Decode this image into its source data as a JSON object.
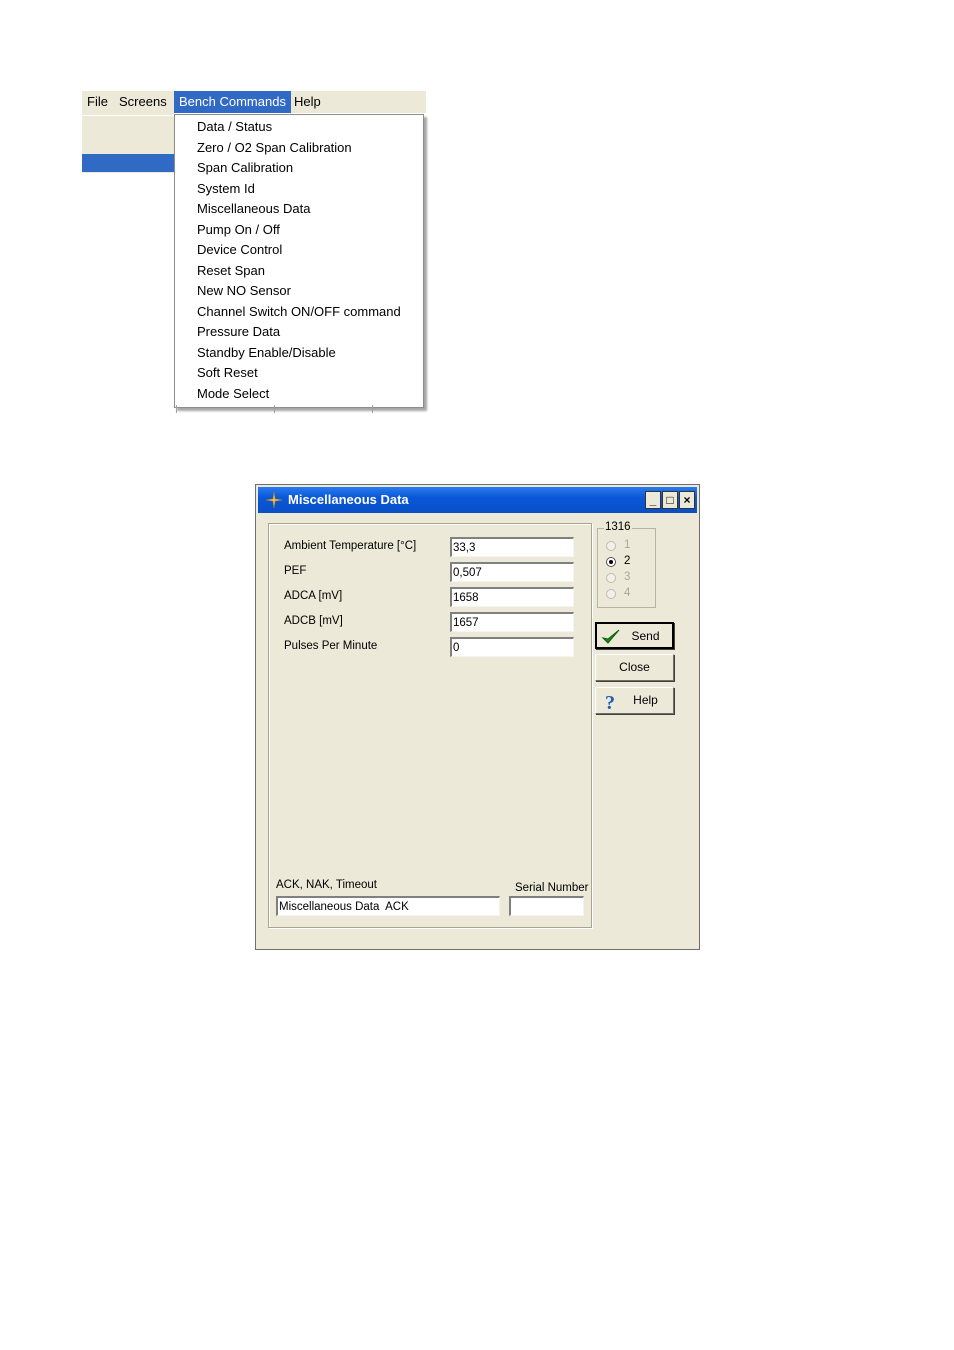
{
  "menubar": {
    "items": [
      {
        "label": "File"
      },
      {
        "label": "Screens"
      },
      {
        "label": "Bench Commands",
        "active": true
      },
      {
        "label": "Help"
      }
    ]
  },
  "bench_commands_menu": {
    "items": [
      "Data / Status",
      "Zero / O2 Span Calibration",
      "Span Calibration",
      "System Id",
      "Miscellaneous Data",
      "Pump On / Off",
      "Device Control",
      "Reset Span",
      "New NO Sensor",
      "Channel Switch ON/OFF command",
      "Pressure Data",
      "Standby Enable/Disable",
      "Soft Reset",
      "Mode Select"
    ]
  },
  "dialog": {
    "title": "Miscellaneous Data",
    "title_icon": "crosshair-star-icon",
    "window_buttons": {
      "minimize": "_",
      "maximize": "□",
      "close": "×"
    },
    "fields": [
      {
        "label": "Ambient Temperature [°C]",
        "value": "33,3"
      },
      {
        "label": "PEF",
        "value": "0,507"
      },
      {
        "label": "ADCA [mV]",
        "value": "1658"
      },
      {
        "label": "ADCB [mV]",
        "value": "1657"
      },
      {
        "label": "Pulses Per Minute",
        "value": "0"
      }
    ],
    "status": {
      "label": "ACK, NAK, Timeout",
      "value": "Miscellaneous Data  ACK"
    },
    "serial_number": {
      "label": "Serial Number",
      "value": ""
    },
    "channel_group": {
      "title": "1316",
      "options": [
        {
          "label": "1",
          "selected": false,
          "enabled": false
        },
        {
          "label": "2",
          "selected": true,
          "enabled": true
        },
        {
          "label": "3",
          "selected": false,
          "enabled": false
        },
        {
          "label": "4",
          "selected": false,
          "enabled": false
        }
      ]
    },
    "buttons": {
      "send": "Send",
      "close": "Close",
      "help": "Help"
    },
    "colors": {
      "titlebar": "#0a57d8",
      "face": "#ece9d8",
      "menu_highlight": "#316ac5"
    }
  }
}
